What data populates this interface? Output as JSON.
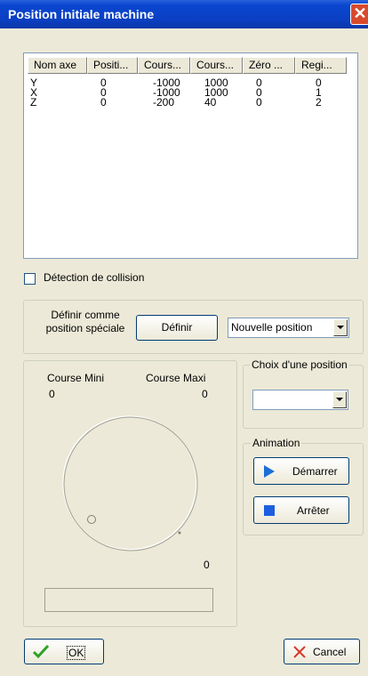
{
  "window": {
    "title": "Position initiale machine",
    "close_glyph": "✕"
  },
  "table": {
    "columns": [
      "Nom axe",
      "Positi...",
      "Cours...",
      "Cours...",
      "Zéro ...",
      "Regi..."
    ],
    "rows": [
      [
        "Y",
        "0",
        "-1000",
        "1000",
        "0",
        "0"
      ],
      [
        "X",
        "0",
        "-1000",
        "1000",
        "0",
        "1"
      ],
      [
        "Z",
        "0",
        "-200",
        "40",
        "0",
        "2"
      ]
    ]
  },
  "collision": {
    "label": "Détection de collision",
    "checked": false
  },
  "special": {
    "label_line1": "Définir comme",
    "label_line2": "position spéciale",
    "define_button": "Définir",
    "dropdown_value": "Nouvelle position"
  },
  "course": {
    "mini_label": "Course Mini",
    "maxi_label": "Course Maxi",
    "mini_value": "0",
    "maxi_value": "0",
    "dial_value": "0"
  },
  "choice": {
    "legend": "Choix d'une position",
    "value": ""
  },
  "animation": {
    "legend": "Animation",
    "start_label": "Démarrer",
    "stop_label": "Arrêter"
  },
  "footer": {
    "ok_label": "OK",
    "cancel_label": "Cancel"
  },
  "colors": {
    "title_bar": "#0a46d0",
    "close": "#d9492c",
    "ok_check": "#2ba226",
    "cancel_x": "#d23a2a",
    "play": "#1b6fd6",
    "stop": "#1b5fe0"
  },
  "icons": [
    "close-icon",
    "dropdown-arrow-icon",
    "play-icon",
    "stop-icon",
    "check-icon",
    "cancel-x-icon"
  ]
}
